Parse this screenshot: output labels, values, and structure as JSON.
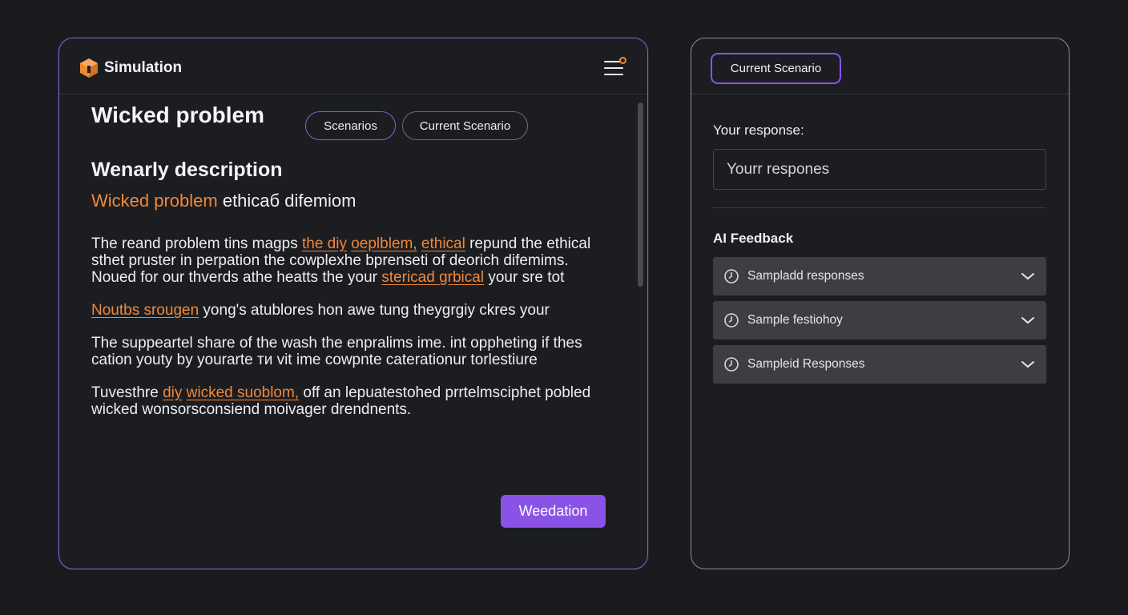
{
  "app": {
    "title": "Simulation"
  },
  "left": {
    "problem_title": "Wicked problem",
    "pills": [
      "Scenarios",
      "Current Scenario"
    ],
    "section_heading": "Wenarly description",
    "subheading_accent": "Wicked problem",
    "subheading_rest": " ethicaб difemiom",
    "paragraphs": {
      "p1": {
        "a": "The reand problem tins magps ",
        "h1": "the diy",
        "b": " ",
        "h2": "oeplblem,",
        "c": " ",
        "h3": "ethical",
        "d": " repund the ethical sthet pruster in perpation the cowplexhe bprenseti of deorich difemims.",
        "e": "Noued for our thverds athe heatts the your ",
        "h4": "stericad grbical",
        "f": " your sre tot"
      },
      "p2": {
        "h1": "Noutbs srougen",
        "a": " yong's atublores hon awe tung theygrgiy ckres your"
      },
      "p3": {
        "a": "The suppeartel share of the wash the enpralims ime. int oppheting if thes cation youty by yourarte ти vit ime cowpnte caterationur torlestiure"
      },
      "p4": {
        "a": "Tuvesthre ",
        "h1": "diy",
        "b": " ",
        "h2": "wicked suoblom,",
        "c": " off an lepuatestohed prrtelmsciphet pobled wicked wonsorsconsiend moivager drendnents."
      }
    },
    "action_button": "Weedation"
  },
  "right": {
    "tab_label": "Current Scenario",
    "response_label": "Your response:",
    "response_placeholder": "Yourr respones",
    "feedback_label": "AI Feedback",
    "accordions": [
      {
        "label": "Sampladd responses"
      },
      {
        "label": "Sample festiohoy"
      },
      {
        "label": "Sampleid Responses"
      }
    ]
  },
  "colors": {
    "accent_purple": "#8b52e8",
    "accent_orange": "#f0883a",
    "background": "#1a1b1f"
  },
  "icons": [
    "logo-icon",
    "menu-icon",
    "notification-dot-icon",
    "clock-icon",
    "chevron-down-icon"
  ]
}
